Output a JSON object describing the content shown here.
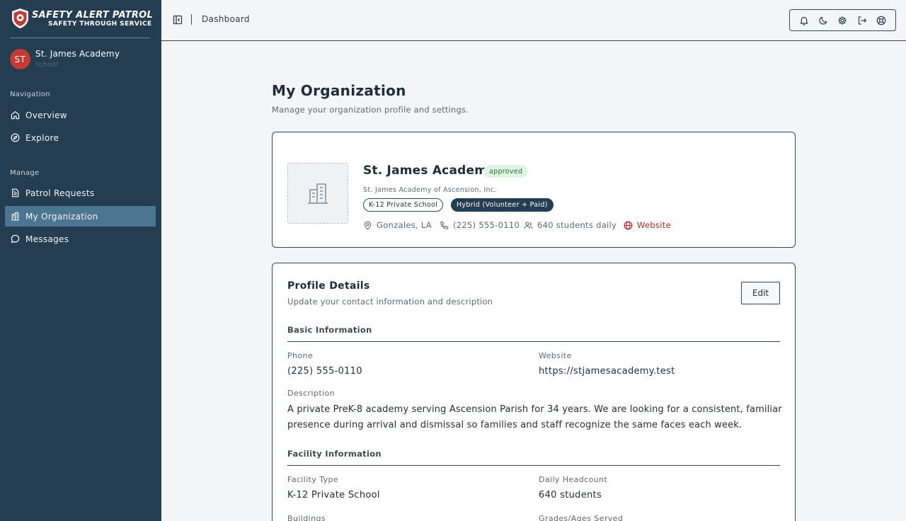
{
  "brand": {
    "title": "SAFETY ALERT PATROL",
    "subtitle": "SAFETY THROUGH SERVICE"
  },
  "org_switcher": {
    "initials": "ST",
    "name": "St. James Academy",
    "type": "school"
  },
  "nav": {
    "section_navigation": "Navigation",
    "overview": "Overview",
    "explore": "Explore",
    "section_manage": "Manage",
    "patrol_requests": "Patrol Requests",
    "my_organization": "My Organization",
    "messages": "Messages"
  },
  "topbar": {
    "breadcrumb": "Dashboard",
    "icons": [
      "bell-icon",
      "moon-icon",
      "gear-icon",
      "logout-icon",
      "support-icon"
    ]
  },
  "page": {
    "title": "My Organization",
    "subtitle": "Manage your organization profile and settings."
  },
  "summary": {
    "name": "St. James Academy",
    "status": "approved",
    "legal_name": "St. James Academy of Ascension, Inc.",
    "tags": [
      "K-12 Private School",
      "Hybrid (Volunteer + Paid)"
    ],
    "location": "Gonzales, LA",
    "phone": "(225) 555-0110",
    "students": "640 students daily",
    "website_label": "Website"
  },
  "profile": {
    "title": "Profile Details",
    "subtitle": "Update your contact information and description",
    "edit_label": "Edit",
    "basic_title": "Basic Information",
    "phone_label": "Phone",
    "phone_value": "(225) 555-0110",
    "website_label": "Website",
    "website_value": "https://stjamesacademy.test",
    "description_label": "Description",
    "description_value": "A private PreK-8 academy serving Ascension Parish for 34 years. We are looking for a consistent, familiar presence during arrival and dismissal so families and staff recognize the same faces each week.",
    "facility_title": "Facility Information",
    "facility_type_label": "Facility Type",
    "facility_type_value": "K-12 Private School",
    "headcount_label": "Daily Headcount",
    "headcount_value": "640 students",
    "buildings_label": "Buildings",
    "grades_label": "Grades/Ages Served"
  },
  "colors": {
    "sidebar": "#243d50",
    "active_nav": "#4b7590",
    "accent_red": "#b3271e",
    "approved_bg": "#dff5e3",
    "approved_text": "#256b38"
  }
}
